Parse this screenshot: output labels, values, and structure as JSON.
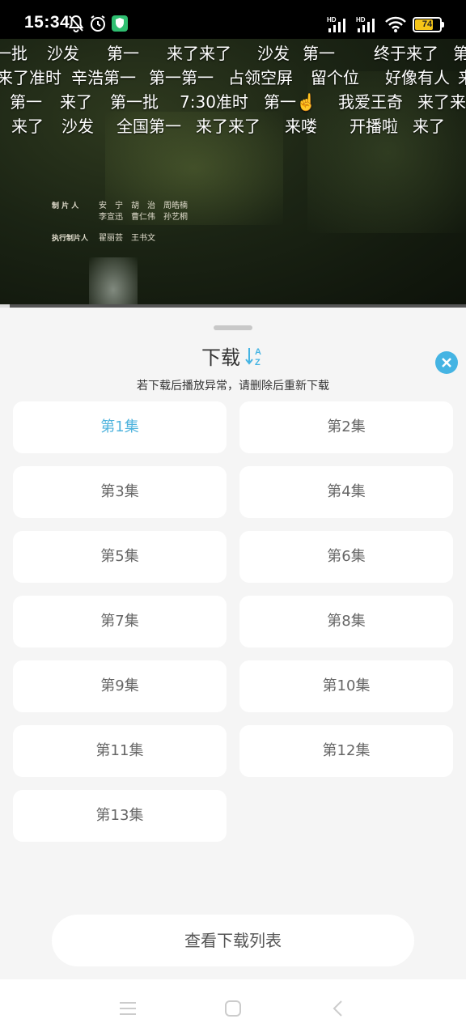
{
  "status_bar": {
    "time": "15:34",
    "battery_level": "74",
    "battery_color": "#f5c518",
    "icons": [
      "bell-off-icon",
      "alarm-icon",
      "vpn-shield-icon",
      "hd-signal-icon",
      "hd-signal-icon",
      "wifi-icon",
      "battery-icon"
    ],
    "hd_label": "HD"
  },
  "video": {
    "danmaku": [
      [
        "一批",
        "沙发",
        "第一",
        "来了来了",
        "沙发",
        "第一",
        "终于来了",
        "第"
      ],
      [
        "来了准时",
        "辛浩第一",
        "第一第一",
        "占领空屏",
        "留个位",
        "好像有人",
        "来"
      ],
      [
        "第一",
        "来了",
        "第一批",
        "7:30准时",
        "第一☝️",
        "我爱王奇",
        "来了来"
      ],
      [
        "来了",
        "沙发",
        "全国第一",
        "来了来了",
        "来喽",
        "开播啦",
        "来了"
      ]
    ],
    "credits": {
      "producers_label": "制 片 人",
      "producers_line1": "安　宁　胡　治　周皓楠",
      "producers_line2": "李宣迅　曹仁伟　孙艺桐",
      "exec_label": "执行制片人",
      "exec_line": "翟丽芸　王书文"
    },
    "progress": 0.02
  },
  "sheet": {
    "title": "下载",
    "sort_icon": "sort-az-icon",
    "close_icon": "close-icon",
    "notice": "若下载后播放异常，请删除后重新下载",
    "accent_color": "#45b4e3",
    "episodes": [
      "第1集",
      "第2集",
      "第3集",
      "第4集",
      "第5集",
      "第6集",
      "第7集",
      "第8集",
      "第9集",
      "第10集",
      "第11集",
      "第12集",
      "第13集"
    ],
    "selected_episode": "第1集",
    "view_list_label": "查看下载列表"
  },
  "nav_bar": {
    "icons": [
      "menu-icon",
      "home-icon",
      "back-icon"
    ]
  }
}
